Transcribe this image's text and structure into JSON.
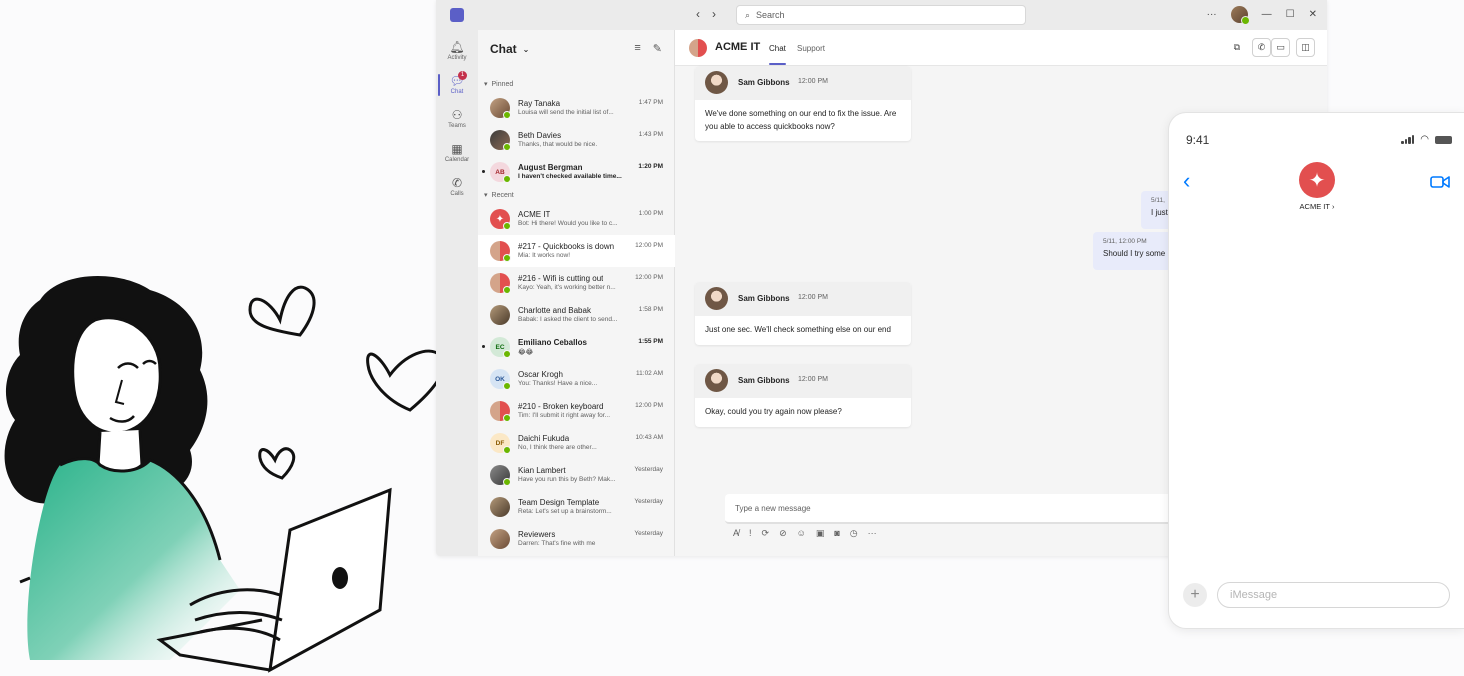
{
  "titlebar": {
    "search_placeholder": "Search",
    "more": "···"
  },
  "rail": [
    {
      "label": "Activity",
      "icon": "bell-icon"
    },
    {
      "label": "Chat",
      "icon": "chat-icon",
      "badge": "1"
    },
    {
      "label": "Teams",
      "icon": "teams-icon"
    },
    {
      "label": "Calendar",
      "icon": "calendar-icon"
    },
    {
      "label": "Calls",
      "icon": "phone-icon"
    }
  ],
  "chatlist": {
    "title": "Chat",
    "pinned_label": "Pinned",
    "recent_label": "Recent",
    "pinned": [
      {
        "name": "Ray Tanaka",
        "preview": "Louisa will send the initial list of...",
        "time": "1:47 PM"
      },
      {
        "name": "Beth Davies",
        "preview": "Thanks, that would be nice.",
        "time": "1:43 PM"
      },
      {
        "name": "August Bergman",
        "initials": "AB",
        "preview": "I haven't checked available time...",
        "time": "1:20 PM"
      }
    ],
    "recent": [
      {
        "name": "ACME IT",
        "preview": "Bot: Hi there! Would you like to c...",
        "time": "1:00 PM"
      },
      {
        "name": "#217 - Quickbooks is down",
        "preview": "Mia: It works now!",
        "time": "12:00 PM"
      },
      {
        "name": "#216 - Wifi is cutting out",
        "preview": "Kayo: Yeah, it's working better n...",
        "time": "12:00 PM"
      },
      {
        "name": "Charlotte and Babak",
        "preview": "Babak: I asked the client to send...",
        "time": "1:58 PM"
      },
      {
        "name": "Emiliano Ceballos",
        "initials": "EC",
        "preview": "😂😂",
        "time": "1:55 PM"
      },
      {
        "name": "Oscar Krogh",
        "initials": "OK",
        "preview": "You: Thanks! Have a nice...",
        "time": "11:02 AM"
      },
      {
        "name": "#210 - Broken keyboard",
        "preview": "Tim: I'll submit it right away for...",
        "time": "12:00 PM"
      },
      {
        "name": "Daichi Fukuda",
        "initials": "DF",
        "preview": "No, I think there are other...",
        "time": "10:43 AM"
      },
      {
        "name": "Kian Lambert",
        "preview": "Have you run this by Beth? Mak...",
        "time": "Yesterday"
      },
      {
        "name": "Team Design Template",
        "preview": "Reta: Let's set up a brainstorm...",
        "time": "Yesterday"
      },
      {
        "name": "Reviewers",
        "preview": "Darren: That's fine with me",
        "time": "Yesterday"
      }
    ]
  },
  "conversation": {
    "title": "ACME IT",
    "tabs": [
      "Chat",
      "Support"
    ],
    "messages": [
      {
        "author": "Sam Gibbons",
        "time": "12:00 PM",
        "text": "We've done something on our end to fix the issue. Are you able to access quickbooks now?"
      },
      {
        "author": "Sam Gibbons",
        "time": "12:00 PM",
        "text": "Just one sec. We'll check something else on our end"
      },
      {
        "author": "Sam Gibbons",
        "time": "12:00 PM",
        "text": "Okay, could you try again now please?"
      }
    ],
    "mine": [
      {
        "meta": "5/11,",
        "text": "I just"
      },
      {
        "meta": "5/11, 12:00 PM",
        "text": "Should I try some"
      }
    ],
    "composer_placeholder": "Type a new message"
  },
  "phone": {
    "time": "9:41",
    "contact": "ACME IT",
    "input_placeholder": "iMessage"
  },
  "colors": {
    "accent": "#5b5fc7",
    "acme_red": "#e24f4f",
    "presence": "#6bb700",
    "ios_blue": "#007aff"
  }
}
